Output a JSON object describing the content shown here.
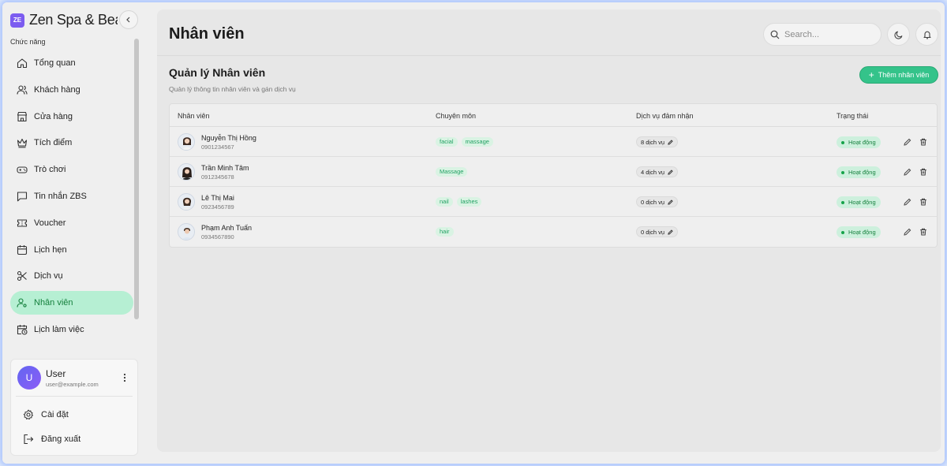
{
  "brand": {
    "logo": "ZE",
    "name": "Zen Spa & Beauty"
  },
  "sidebar": {
    "section_label": "Chức năng",
    "items": [
      {
        "label": "Tổng quan",
        "icon": "home-icon"
      },
      {
        "label": "Khách hàng",
        "icon": "users-icon"
      },
      {
        "label": "Cửa hàng",
        "icon": "store-icon"
      },
      {
        "label": "Tích điểm",
        "icon": "crown-icon"
      },
      {
        "label": "Trò chơi",
        "icon": "gamepad-icon"
      },
      {
        "label": "Tin nhắn ZBS",
        "icon": "message-icon"
      },
      {
        "label": "Voucher",
        "icon": "ticket-icon"
      },
      {
        "label": "Lịch hẹn",
        "icon": "calendar-icon"
      },
      {
        "label": "Dịch vụ",
        "icon": "scissors-icon"
      },
      {
        "label": "Nhân viên",
        "icon": "user-cog-icon",
        "active": true
      },
      {
        "label": "Lịch làm việc",
        "icon": "calendar-clock-icon"
      }
    ],
    "active_color": "#b6efd3"
  },
  "user": {
    "initial": "U",
    "name": "User",
    "email": "user@example.com",
    "settings_label": "Cài đặt",
    "logout_label": "Đăng xuất"
  },
  "header": {
    "title": "Nhân viên",
    "search_placeholder": "Search..."
  },
  "section": {
    "title": "Quản lý Nhân viên",
    "subtitle": "Quản lý thông tin nhân viên và gán dịch vụ",
    "add_label": "Thêm nhân viên",
    "accent": "#34c38a"
  },
  "table": {
    "columns": [
      "Nhân viên",
      "Chuyên môn",
      "Dịch vụ đảm nhận",
      "Trạng thái"
    ],
    "rows": [
      {
        "name": "Nguyễn Thị Hồng",
        "phone": "0901234567",
        "tags": [
          "facial",
          "massage"
        ],
        "services": "8 dịch vụ",
        "status": "Hoạt động"
      },
      {
        "name": "Trần Minh Tâm",
        "phone": "0912345678",
        "tags": [
          "Massage"
        ],
        "services": "4 dịch vụ",
        "status": "Hoạt động"
      },
      {
        "name": "Lê Thị Mai",
        "phone": "0923456789",
        "tags": [
          "nail",
          "lashes"
        ],
        "services": "0 dịch vụ",
        "status": "Hoạt động"
      },
      {
        "name": "Phạm Anh Tuấn",
        "phone": "0934567890",
        "tags": [
          "hair"
        ],
        "services": "0 dịch vụ",
        "status": "Hoạt động"
      }
    ]
  }
}
